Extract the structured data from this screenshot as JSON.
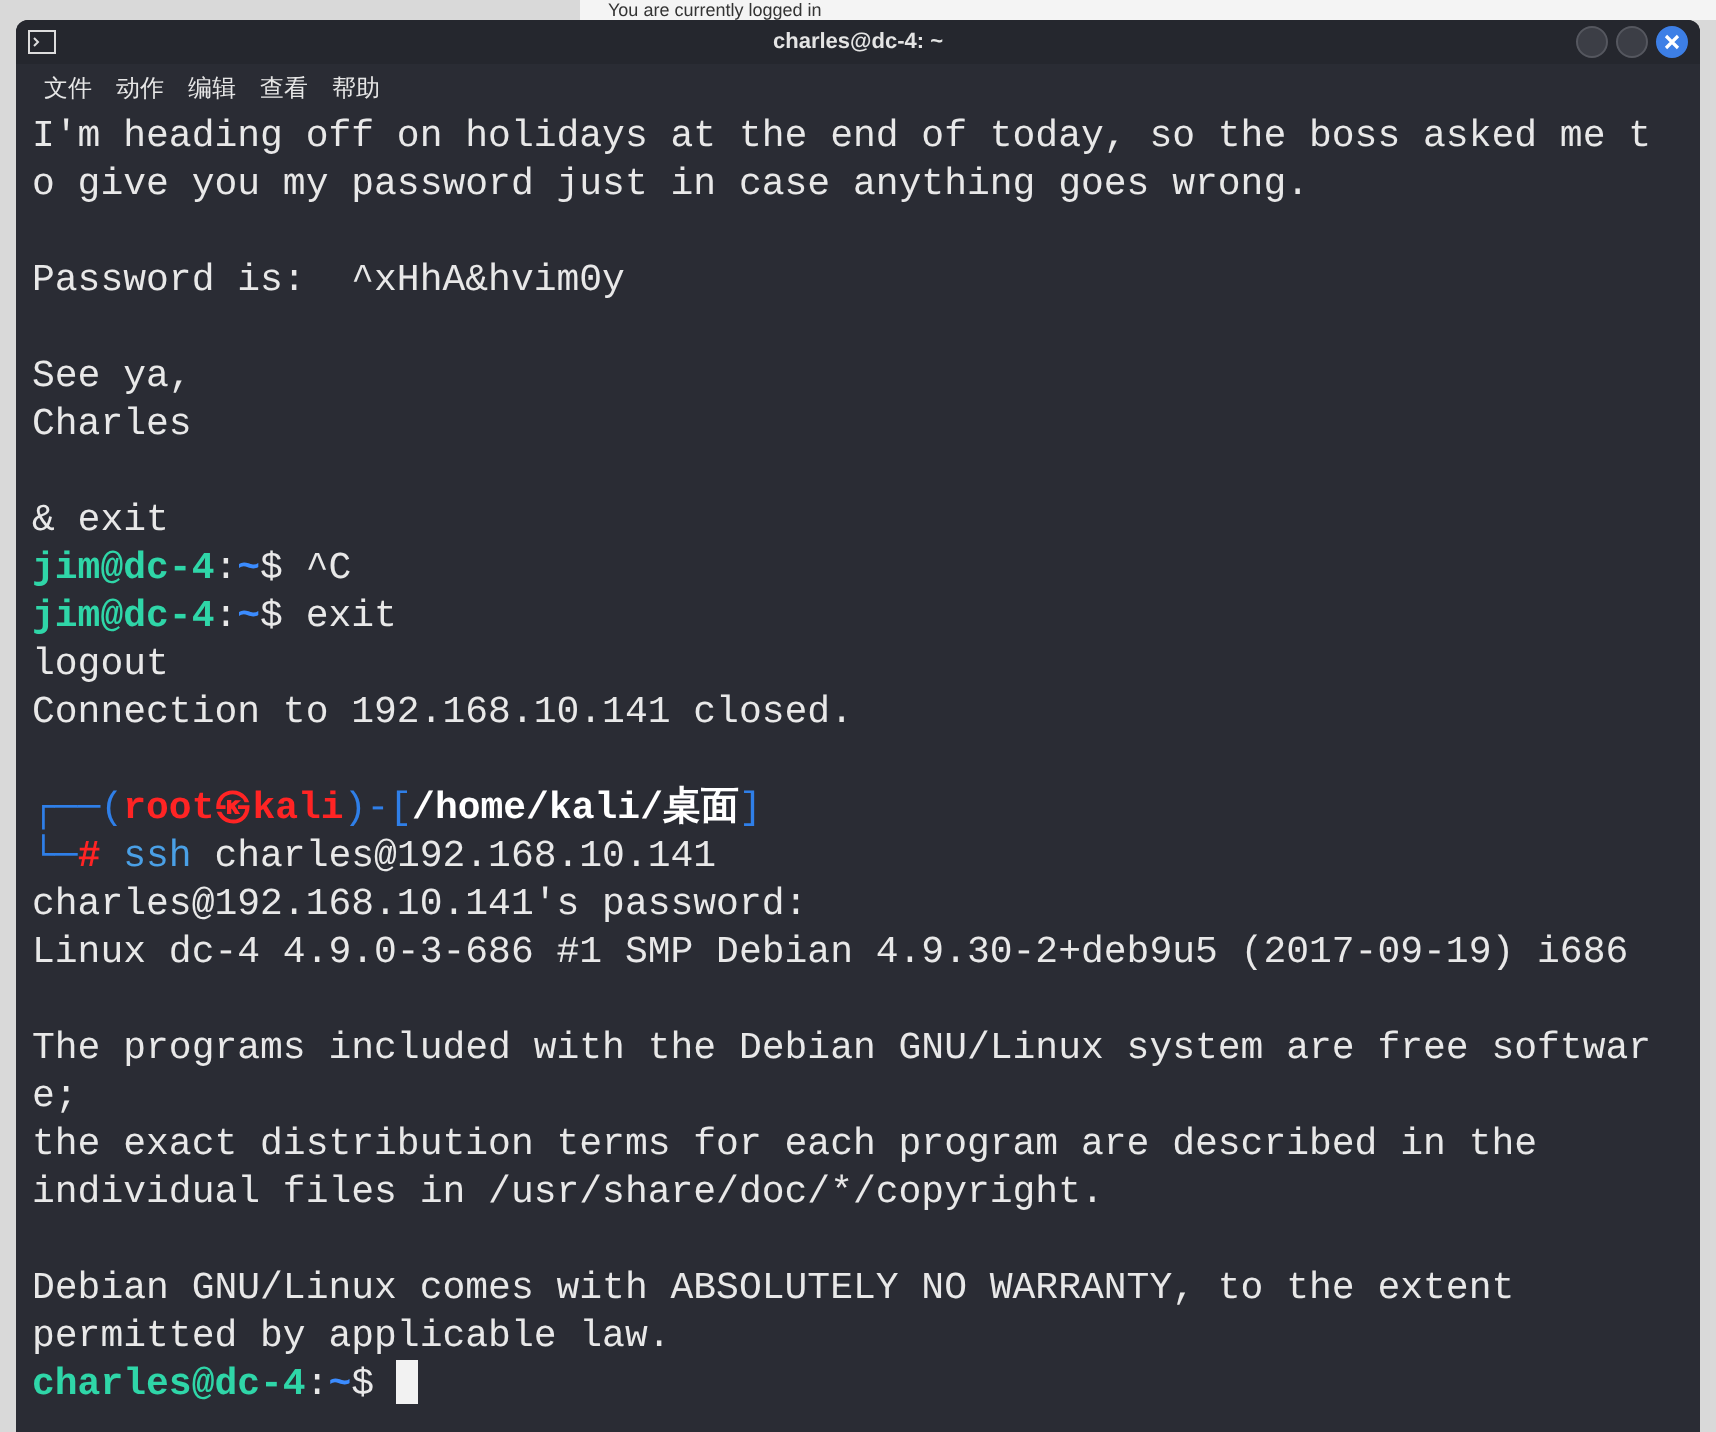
{
  "backdrop": {
    "text": "You are currently logged in"
  },
  "window": {
    "title": "charles@dc-4: ~"
  },
  "menu": [
    "文件",
    "动作",
    "编辑",
    "查看",
    "帮助"
  ],
  "lines": [
    {
      "kind": "text",
      "segments": [
        {
          "kind": "plain",
          "text": "I'm heading off on holidays at the end of today, so the boss asked me t"
        }
      ]
    },
    {
      "kind": "text",
      "segments": [
        {
          "kind": "plain",
          "text": "o give you my password just in case anything goes wrong."
        }
      ]
    },
    {
      "kind": "blank"
    },
    {
      "kind": "text",
      "segments": [
        {
          "kind": "plain",
          "text": "Password is:  ^xHhA&hvim0y"
        }
      ]
    },
    {
      "kind": "blank"
    },
    {
      "kind": "text",
      "segments": [
        {
          "kind": "plain",
          "text": "See ya,"
        }
      ]
    },
    {
      "kind": "text",
      "segments": [
        {
          "kind": "plain",
          "text": "Charles"
        }
      ]
    },
    {
      "kind": "blank"
    },
    {
      "kind": "text",
      "segments": [
        {
          "kind": "plain",
          "text": "& exit"
        }
      ]
    },
    {
      "kind": "text",
      "segments": [
        {
          "kind": "user",
          "text": "jim@dc-4"
        },
        {
          "kind": "plain",
          "text": ":"
        },
        {
          "kind": "dir",
          "text": "~"
        },
        {
          "kind": "plain",
          "text": "$ ^C"
        }
      ]
    },
    {
      "kind": "text",
      "segments": [
        {
          "kind": "user",
          "text": "jim@dc-4"
        },
        {
          "kind": "plain",
          "text": ":"
        },
        {
          "kind": "dir",
          "text": "~"
        },
        {
          "kind": "plain",
          "text": "$ exit"
        }
      ]
    },
    {
      "kind": "text",
      "segments": [
        {
          "kind": "plain",
          "text": "logout"
        }
      ]
    },
    {
      "kind": "text",
      "segments": [
        {
          "kind": "plain",
          "text": "Connection to 192.168.10.141 closed."
        }
      ]
    },
    {
      "kind": "blank"
    },
    {
      "kind": "text",
      "segments": [
        {
          "kind": "frame",
          "text": "┌──("
        },
        {
          "kind": "root",
          "text": "root㉿kali"
        },
        {
          "kind": "frame",
          "text": ")-["
        },
        {
          "kind": "path",
          "text": "/home/kali/桌面"
        },
        {
          "kind": "frame",
          "text": "]"
        }
      ]
    },
    {
      "kind": "text",
      "segments": [
        {
          "kind": "frame",
          "text": "└─"
        },
        {
          "kind": "root",
          "text": "#"
        },
        {
          "kind": "command",
          "text": " ssh"
        },
        {
          "kind": "plain",
          "text": " charles@192.168.10.141"
        }
      ]
    },
    {
      "kind": "text",
      "segments": [
        {
          "kind": "plain",
          "text": "charles@192.168.10.141's password:"
        }
      ]
    },
    {
      "kind": "text",
      "segments": [
        {
          "kind": "plain",
          "text": "Linux dc-4 4.9.0-3-686 #1 SMP Debian 4.9.30-2+deb9u5 (2017-09-19) i686"
        }
      ]
    },
    {
      "kind": "blank"
    },
    {
      "kind": "text",
      "segments": [
        {
          "kind": "plain",
          "text": "The programs included with the Debian GNU/Linux system are free softwar"
        }
      ]
    },
    {
      "kind": "text",
      "segments": [
        {
          "kind": "plain",
          "text": "e;"
        }
      ]
    },
    {
      "kind": "text",
      "segments": [
        {
          "kind": "plain",
          "text": "the exact distribution terms for each program are described in the"
        }
      ]
    },
    {
      "kind": "text",
      "segments": [
        {
          "kind": "plain",
          "text": "individual files in /usr/share/doc/*/copyright."
        }
      ]
    },
    {
      "kind": "blank"
    },
    {
      "kind": "text",
      "segments": [
        {
          "kind": "plain",
          "text": "Debian GNU/Linux comes with ABSOLUTELY NO WARRANTY, to the extent"
        }
      ]
    },
    {
      "kind": "text",
      "segments": [
        {
          "kind": "plain",
          "text": "permitted by applicable law."
        }
      ]
    },
    {
      "kind": "text",
      "cursor": true,
      "segments": [
        {
          "kind": "user",
          "text": "charles@dc-4"
        },
        {
          "kind": "plain",
          "text": ":"
        },
        {
          "kind": "dir",
          "text": "~"
        },
        {
          "kind": "plain",
          "text": "$ "
        }
      ]
    }
  ]
}
